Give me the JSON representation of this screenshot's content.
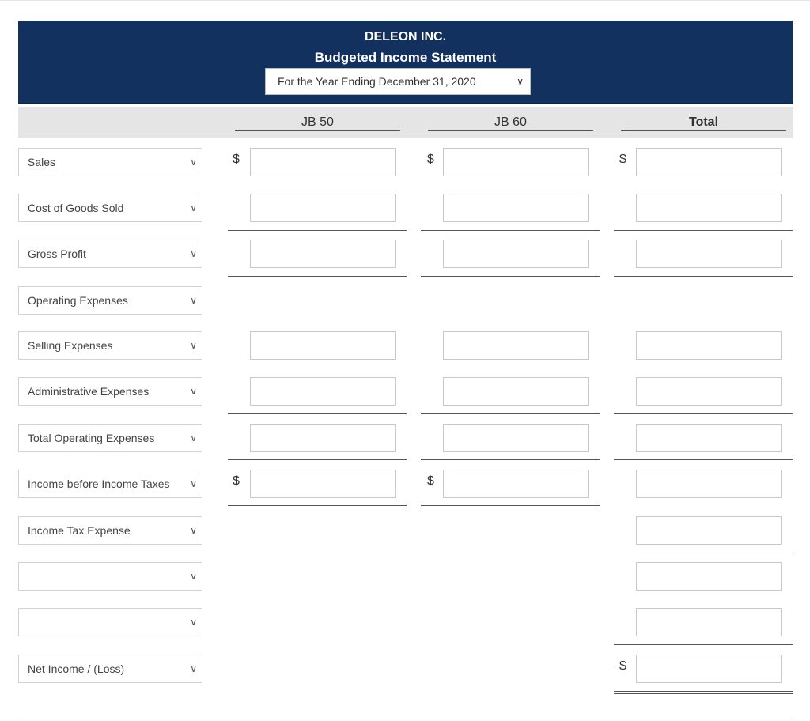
{
  "header": {
    "company": "DELEON INC.",
    "title": "Budgeted Income Statement",
    "period_value": "For the Year Ending December 31, 2020"
  },
  "columns": {
    "jb50": "JB 50",
    "jb60": "JB 60",
    "total": "Total"
  },
  "currency_symbol": "$",
  "rows": [
    {
      "label": "Sales"
    },
    {
      "label": "Cost of Goods Sold"
    },
    {
      "label": "Gross Profit"
    },
    {
      "label": "Operating Expenses"
    },
    {
      "label": "Selling Expenses"
    },
    {
      "label": "Administrative Expenses"
    },
    {
      "label": "Total Operating Expenses"
    },
    {
      "label": "Income before Income Taxes"
    },
    {
      "label": "Income Tax Expense"
    },
    {
      "label": ""
    },
    {
      "label": ""
    },
    {
      "label": "Net Income / (Loss)"
    }
  ],
  "icons": {
    "dropdown": "chevron-down-icon",
    "row_select": "chevron-icon"
  },
  "colors": {
    "header_bg": "#13315e",
    "column_header_bg": "#e5e5e5"
  }
}
